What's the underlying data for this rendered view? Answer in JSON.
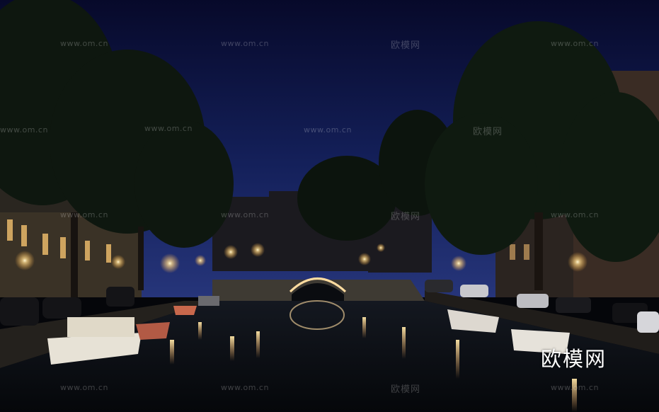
{
  "scene": {
    "description_free": true,
    "colors": {
      "sky_top": "#0a0f33",
      "sky_bottom": "#1d2a6b",
      "foliage": "#0f1a10",
      "water": "#0b0f14",
      "lamp": "#fff2c4"
    }
  },
  "watermarks": {
    "domain": "www.om.cn",
    "brand": "欧模网"
  },
  "logo": {
    "text": "欧模网"
  }
}
